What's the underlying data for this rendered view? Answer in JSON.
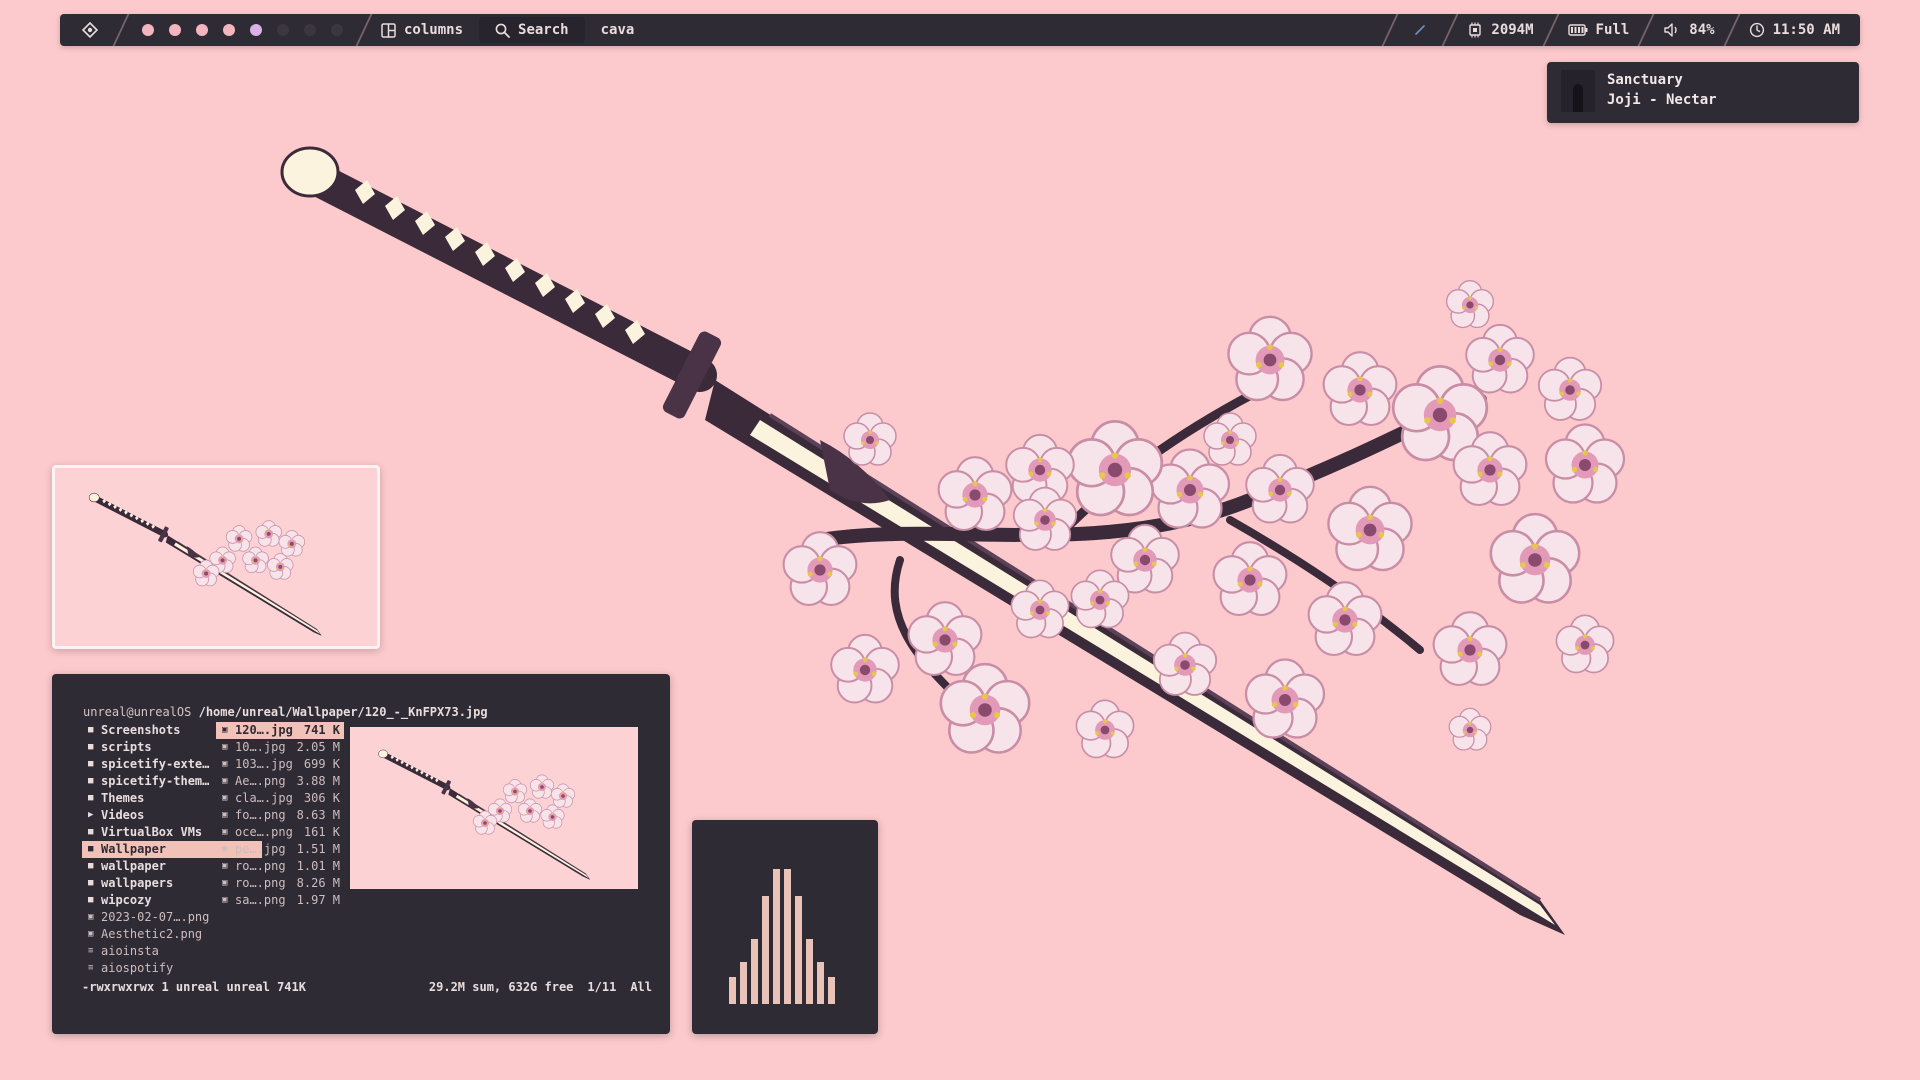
{
  "topbar": {
    "workspaces": [
      {
        "state": "occupied"
      },
      {
        "state": "occupied"
      },
      {
        "state": "occupied"
      },
      {
        "state": "occupied"
      },
      {
        "state": "active"
      },
      {
        "state": "empty"
      },
      {
        "state": "empty"
      },
      {
        "state": "empty"
      }
    ],
    "layout_label": "columns",
    "search_label": "Search",
    "window_title": "cava",
    "memory": "2094M",
    "battery": "Full",
    "volume": "84%",
    "clock": "11:50 AM"
  },
  "now_playing": {
    "title": "Sanctuary",
    "artist_track": "Joji - Nectar"
  },
  "ranger": {
    "user": "unreal@unrealOS",
    "path": "/home/unreal/Wallpaper/120_-_KnFPX73.jpg",
    "dirs": [
      {
        "name": "Screenshots",
        "type": "dir"
      },
      {
        "name": "scripts",
        "type": "dir"
      },
      {
        "name": "spicetify-exte…",
        "type": "dir"
      },
      {
        "name": "spicetify-them…",
        "type": "dir"
      },
      {
        "name": "Themes",
        "type": "dir"
      },
      {
        "name": "Videos",
        "type": "video"
      },
      {
        "name": "VirtualBox VMs",
        "type": "dir"
      },
      {
        "name": "Wallpaper",
        "type": "dir",
        "selected": true
      },
      {
        "name": "wallpaper",
        "type": "dir"
      },
      {
        "name": "wallpapers",
        "type": "dir"
      },
      {
        "name": "wipcozy",
        "type": "dir"
      },
      {
        "name": "2023-02-07….png",
        "type": "image"
      },
      {
        "name": "Aesthetic2.png",
        "type": "image"
      },
      {
        "name": "aioinsta",
        "type": "file"
      },
      {
        "name": "aiospotify",
        "type": "file"
      }
    ],
    "files": [
      {
        "name": "120….jpg",
        "size": "741 K",
        "selected": true
      },
      {
        "name": "10….jpg",
        "size": "2.05 M"
      },
      {
        "name": "103….jpg",
        "size": "699 K"
      },
      {
        "name": "Ae….png",
        "size": "3.88 M"
      },
      {
        "name": "cla….jpg",
        "size": "306 K"
      },
      {
        "name": "fo….png",
        "size": "8.63 M"
      },
      {
        "name": "oce….png",
        "size": "161 K"
      },
      {
        "name": "pe….jpg",
        "size": "1.51 M"
      },
      {
        "name": "ro….png",
        "size": "1.01 M"
      },
      {
        "name": "ro….png",
        "size": "8.26 M"
      },
      {
        "name": "sa….png",
        "size": "1.97 M"
      }
    ],
    "status_perms": "-rwxrwxrwx 1 unreal unreal 741K",
    "status_sum": "29.2M sum, 632G free",
    "status_pos": "1/11",
    "status_all": "All"
  },
  "cava": {
    "bars": [
      0.18,
      0.28,
      0.43,
      0.72,
      0.9,
      0.9,
      0.72,
      0.43,
      0.28,
      0.18
    ]
  },
  "colors": {
    "background": "#fcc9cc",
    "panel": "#2f2b35",
    "accent": "#f2c2b9",
    "workspace_occupied": "#f3b6c0",
    "workspace_active": "#d9b3e8"
  }
}
